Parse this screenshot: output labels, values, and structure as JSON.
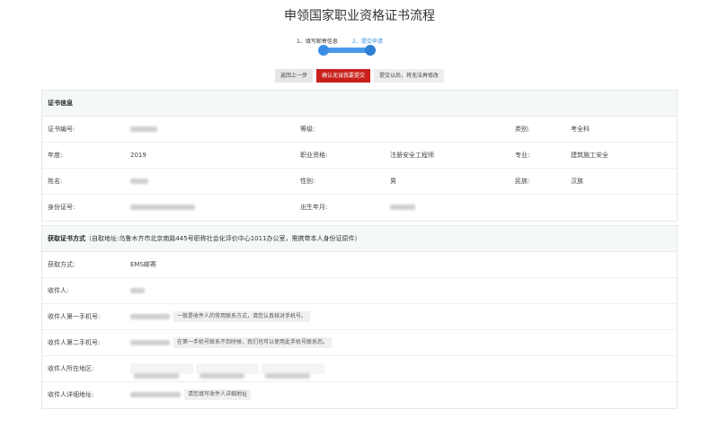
{
  "page": {
    "title": "申领国家职业资格证书流程"
  },
  "steps": [
    {
      "label": "1、填写邮寄信息"
    },
    {
      "label": "2、提交申请"
    }
  ],
  "actions": {
    "back_label": "返回上一步",
    "confirm_label": "确认无误我要提交",
    "note": "提交以后，将无法再修改"
  },
  "certificate": {
    "header": "证书信息",
    "rows": [
      [
        {
          "label": "证书编号:",
          "value": ""
        },
        {
          "label": "等级:",
          "value": ""
        },
        {
          "label": "类别:",
          "value": "考全科"
        }
      ],
      [
        {
          "label": "年度:",
          "value": "2019"
        },
        {
          "label": "职业资格:",
          "value": "注册安全工程师"
        },
        {
          "label": "专业:",
          "value": "建筑施工安全"
        }
      ],
      [
        {
          "label": "姓名:",
          "value": ""
        },
        {
          "label": "性别:",
          "value": "男"
        },
        {
          "label": "民族:",
          "value": "汉族"
        }
      ],
      [
        {
          "label": "身份证号:",
          "value": ""
        },
        {
          "label": "出生年月:",
          "value": ""
        }
      ]
    ]
  },
  "delivery": {
    "header": "获取证书方式",
    "header_note": "（自取地址:乌鲁木齐市北京南路445号职称社会化评价中心1011办公室，需携带本人身份证原件）",
    "method_label": "获取方式:",
    "method_value": "EMS邮寄",
    "recipient_label": "收件人:",
    "phone1_label": "收件人第一手机号:",
    "phone1_hint": "一般是收件人的常用联系方式，请您认真核对手机号。",
    "phone2_label": "收件人第二手机号:",
    "phone2_hint": "在第一手机号联系不到时候，我们也可以使用此手机号联系您。",
    "region_label": "收件人所在地区:",
    "address_label": "收件人详细地址:",
    "address_hint": "请您填写收件人详细地址"
  }
}
